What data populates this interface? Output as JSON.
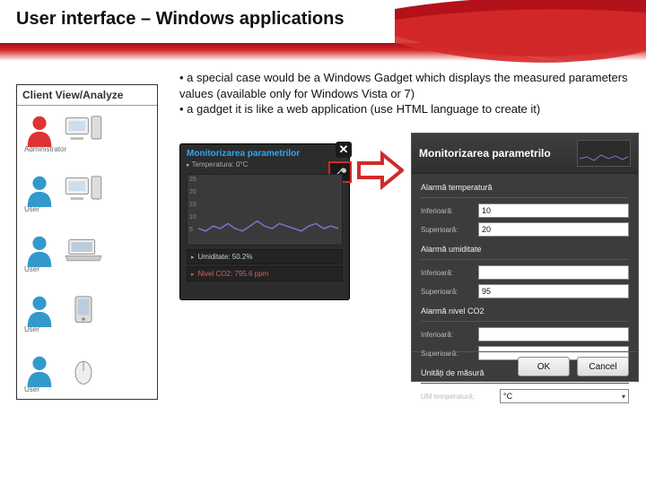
{
  "slide": {
    "title": "User interface – Windows applications",
    "bullet1": "• a special case would be a Windows Gadget which displays the measured parameters values (available only for Windows Vista or 7)",
    "bullet2": "• a gadget it is like a web application (use HTML language to create it)"
  },
  "sidebar": {
    "heading": "Client View/Analyze",
    "rows": [
      {
        "role": "Administrator",
        "avatar": "person-red",
        "device": "desktop"
      },
      {
        "role": "User",
        "avatar": "person-blue",
        "device": "desktop"
      },
      {
        "role": "User",
        "avatar": "person-blue",
        "device": "laptop"
      },
      {
        "role": "User",
        "avatar": "person-blue",
        "device": "pda"
      },
      {
        "role": "User",
        "avatar": "person-blue",
        "device": "mouse"
      }
    ]
  },
  "gadget": {
    "title": "Monitorizarea parametrilor",
    "sub": "Temperatura: 0°C",
    "yticks": [
      "25",
      "20",
      "15",
      "10",
      "5"
    ],
    "row1": "Umiditate: 50.2%",
    "row2": "Nivel CO2: 795.6 ppm",
    "close": "✕"
  },
  "dialog": {
    "title": "Monitorizarea parametrilo",
    "sections": {
      "temp": "Alarmă temperatură",
      "hum": "Alarmă umiditate",
      "co2": "Alarmă nivel CO2",
      "units": "Unități de măsură"
    },
    "labels": {
      "inf": "Inferioară:",
      "sup": "Superioară:",
      "um": "UM temperatură:"
    },
    "values": {
      "temp_inf": "10",
      "temp_sup": "20",
      "hum_inf": "",
      "hum_sup": "95",
      "co2_inf": "",
      "co2_sup": "",
      "um_select": "°C"
    },
    "buttons": {
      "ok": "OK",
      "cancel": "Cancel"
    }
  },
  "chart_data": {
    "type": "line",
    "title": "Temperatura: 0°C",
    "xlabel": "",
    "ylabel": "",
    "ylim": [
      0,
      25
    ],
    "x": [
      0,
      1,
      2,
      3,
      4,
      5,
      6,
      7,
      8,
      9,
      10,
      11,
      12,
      13,
      14,
      15,
      16,
      17,
      18,
      19
    ],
    "values": [
      5,
      4,
      6,
      5,
      7,
      5,
      4,
      6,
      8,
      6,
      5,
      7,
      6,
      5,
      4,
      6,
      7,
      5,
      6,
      5
    ]
  }
}
